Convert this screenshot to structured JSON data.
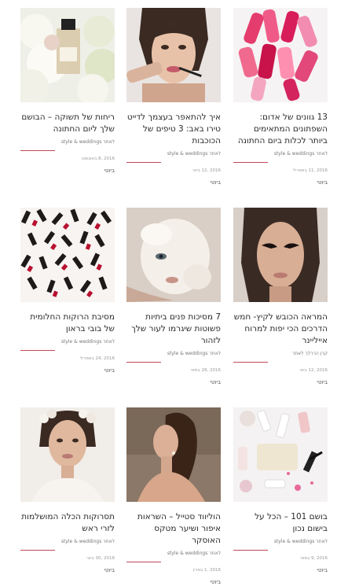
{
  "cards": [
    {
      "title": "13 גוונים של אדום: השפתונים המתאימים ביותר לכלות ביום החתונה",
      "author": "style & weddings לאתר",
      "date": "2016 ,11 באפריל",
      "category": "ביוטי",
      "image_icon": "popsicle-lipstick-image"
    },
    {
      "title": "איך להתאפר בעצמך לדייט טירו באב: 3 טיפים של הכוכבות",
      "author": "style & weddings לאתר",
      "date": "2016 ,12 ביוני",
      "category": "ביוטי",
      "image_icon": "woman-applying-lipstick-image"
    },
    {
      "title": "ריחות של תשוקה – הבושם שלך ליום החתונה",
      "author": "style & weddings לאתר",
      "date": "2016 ,8 באוגוסט",
      "category": "ביוטי",
      "image_icon": "perfume-bottle-flowers-image"
    },
    {
      "title": "המראה הכובש לקיץ- חמש הדרכים הכי יפות למרוח אייליינר",
      "author": "קרן הררלך לאתר",
      "date": "2016 ,12 ביוני",
      "category": "ביוטי",
      "image_icon": "eyeliner-portrait-image"
    },
    {
      "title": "7 מסיכות פנים ביתיות פשוטות שיגרמו לעור שלך לזהור",
      "author": "style & weddings לאתר",
      "date": "2016 ,28 במאי",
      "category": "ביוטי",
      "image_icon": "face-mask-image"
    },
    {
      "title": "מסיבת הרוקות החלומית של בובי בראון",
      "author": "style & weddings לאתר",
      "date": "2016 ,24 באפריל",
      "category": "ביוטי",
      "image_icon": "lipstick-pattern-image"
    },
    {
      "title": "בושם 101 – הכל על בישום נכון",
      "author": "style & weddings לאתר",
      "date": "2016 ,9 במאי",
      "category": "ביוטי",
      "image_icon": "cosmetics-flatlay-image"
    },
    {
      "title": "הוליווד סטייל – השראות איפור ושיער מטקס האוסקר",
      "author": "style & weddings לאתר",
      "date": "2016 ,1 במרץ",
      "category": "ביוטי",
      "image_icon": "hollywood-hairstyle-image"
    },
    {
      "title": "תסרוקות הכלה המושלמות לזרי ראש",
      "author": "style & weddings לאתר",
      "date": "2016 ,30 ביוני",
      "category": "ביוטי",
      "image_icon": "bride-flower-crown-image"
    }
  ],
  "colors": {
    "accent_rule": "#c04a5a",
    "title_text": "#2a2a2a",
    "meta_text": "#777777"
  }
}
